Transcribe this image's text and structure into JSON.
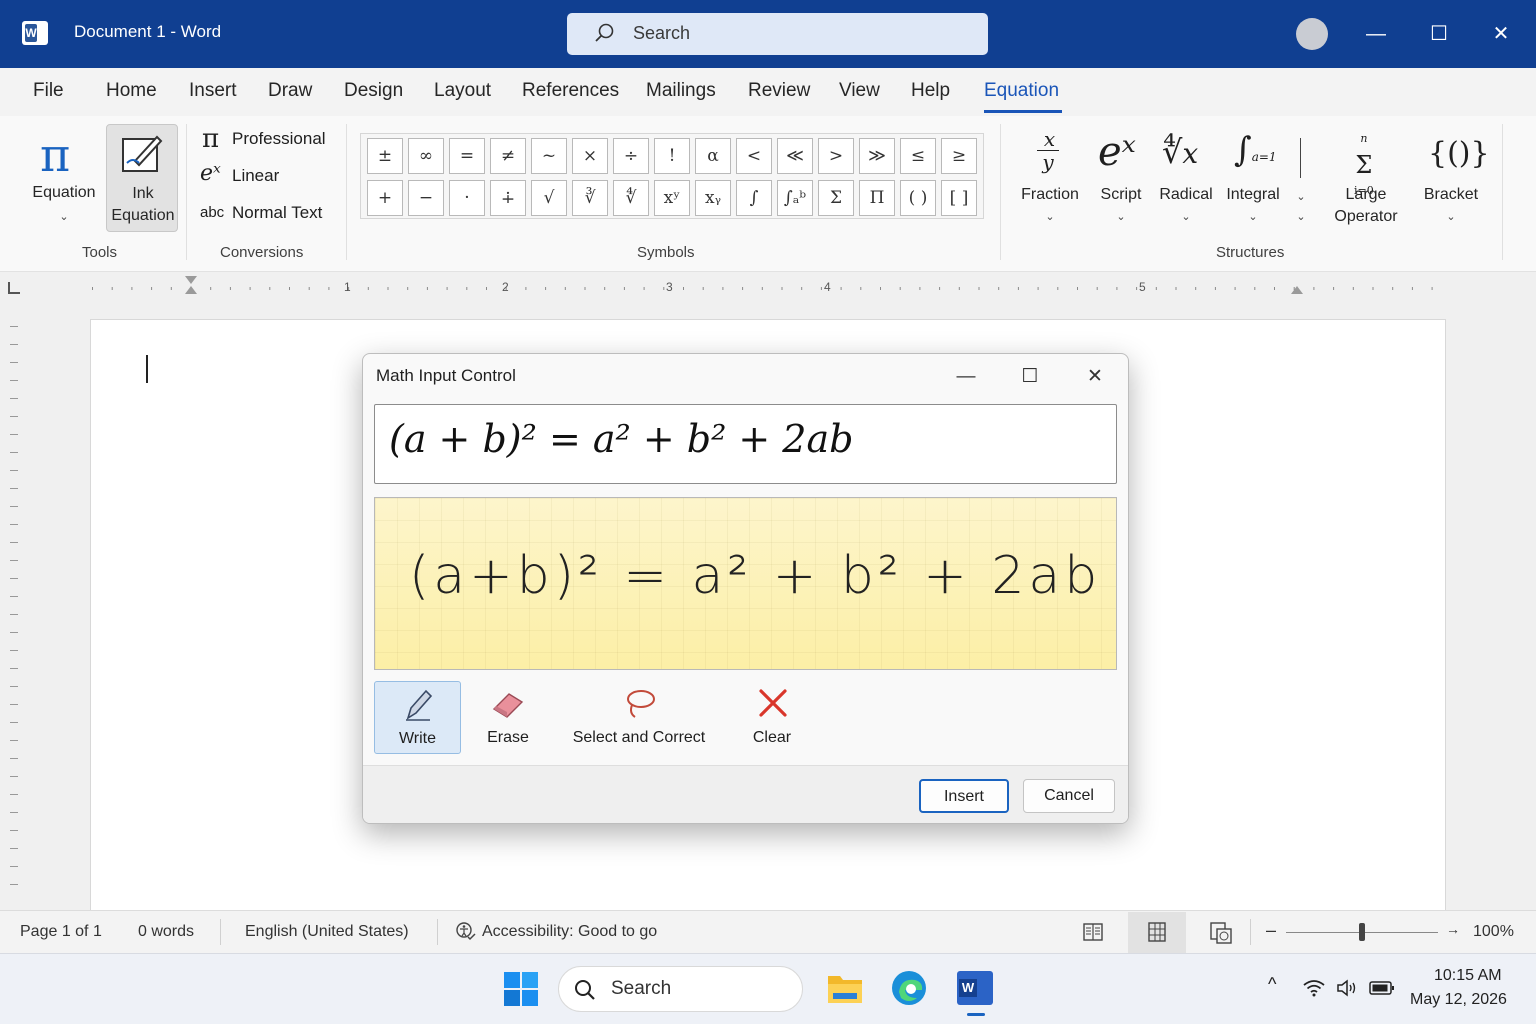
{
  "window": {
    "title": "Document 1  -  Word",
    "app_icon_letter": "W"
  },
  "search": {
    "placeholder": "Search"
  },
  "window_controls": {
    "minimize": "—",
    "maximize": "☐",
    "close": "✕"
  },
  "menu": {
    "tabs": [
      "File",
      "Home",
      "Insert",
      "Draw",
      "Design",
      "Layout",
      "References",
      "Mailings",
      "Review",
      "View",
      "Help",
      "Equation"
    ],
    "active": "Equation"
  },
  "ribbon": {
    "tools": {
      "equation_label": "Equation",
      "ink_label_1": "Ink",
      "ink_label_2": "Equation",
      "group": "Tools"
    },
    "conversions": {
      "professional": "Professional",
      "linear": "Linear",
      "normal_text": "Normal Text",
      "abc": "abc",
      "group": "Conversions"
    },
    "symbols": {
      "row1": [
        "±",
        "∞",
        "=",
        "≠",
        "~",
        "×",
        "÷",
        "!",
        "α",
        "<",
        "≪",
        ">",
        "≫",
        "≤",
        "≥"
      ],
      "row2": [
        "+",
        "−",
        "·",
        "∔",
        "√",
        "∛",
        "∜",
        "xʸ",
        "xᵧ",
        "∫",
        "∫ₐᵇ",
        "Σ",
        "Π",
        "( )",
        "[ ]"
      ],
      "group": "Symbols"
    },
    "structures": {
      "fraction": "Fraction",
      "script": "Script",
      "radical": "Radical",
      "integral": "Integral",
      "large_operator_1": "Large",
      "large_operator_2": "Operator",
      "bracket": "Bracket",
      "group": "Structures"
    }
  },
  "ruler": {
    "numbers": [
      "1",
      "2",
      "3",
      "4",
      "5"
    ]
  },
  "dialog": {
    "title": "Math Input Control",
    "preview": "(a + b)² = a² + b² + 2ab",
    "handwriting": "(a+b)² = a² + b² + 2ab",
    "tools": {
      "write": "Write",
      "erase": "Erase",
      "select_correct": "Select and Correct",
      "clear": "Clear"
    },
    "insert_label": "Insert",
    "cancel_label": "Cancel"
  },
  "status": {
    "page": "Page 1 of 1",
    "words": "0 words",
    "language": "English (United States)",
    "accessibility": "Accessibility: Good to go",
    "zoom": "100%",
    "zoom_level_fraction": 0.5
  },
  "taskbar": {
    "search": "Search",
    "time": "10:15 AM",
    "date": "May 12, 2026"
  },
  "colors": {
    "title_bar": "#103f91",
    "accent": "#1a55b8",
    "clear_red": "#d9362b"
  }
}
